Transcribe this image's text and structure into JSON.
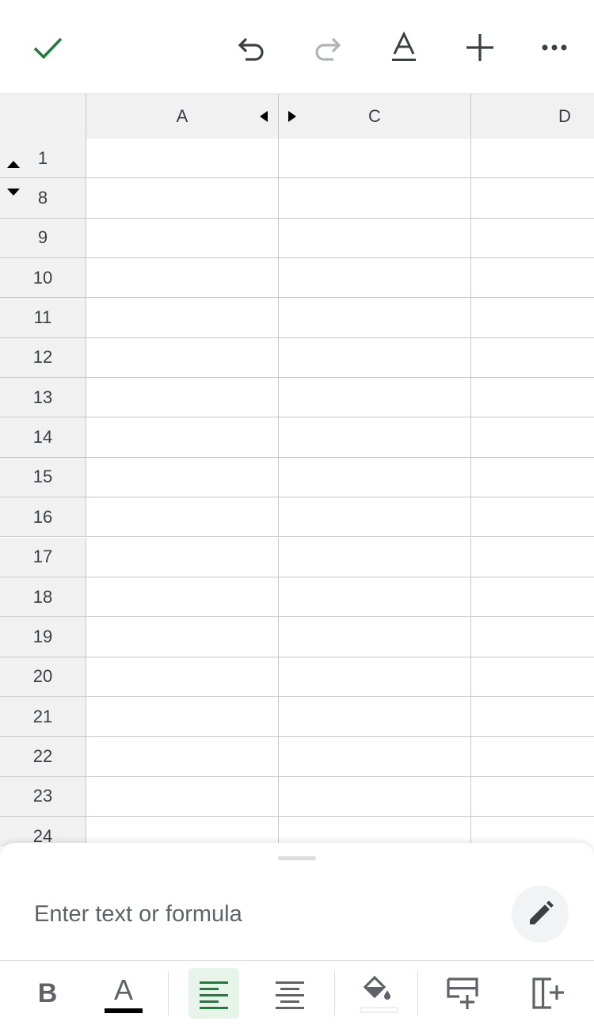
{
  "toolbar": {
    "icons": [
      "check-icon",
      "undo-icon",
      "redo-icon",
      "text-format-icon",
      "add-icon",
      "more-icon"
    ],
    "accent_color": "#188038"
  },
  "grid": {
    "columns": [
      "A",
      "C",
      "D"
    ],
    "rows": [
      "1",
      "8",
      "9",
      "10",
      "11",
      "12",
      "13",
      "14",
      "15",
      "16",
      "17",
      "18",
      "19",
      "20",
      "21",
      "22",
      "23",
      "24"
    ]
  },
  "editor": {
    "placeholder": "Enter text or formula"
  },
  "format_bar": {
    "bold_label": "B",
    "text_color_label": "A",
    "active_button": "align-left",
    "active_color": "#e6f4ea"
  }
}
